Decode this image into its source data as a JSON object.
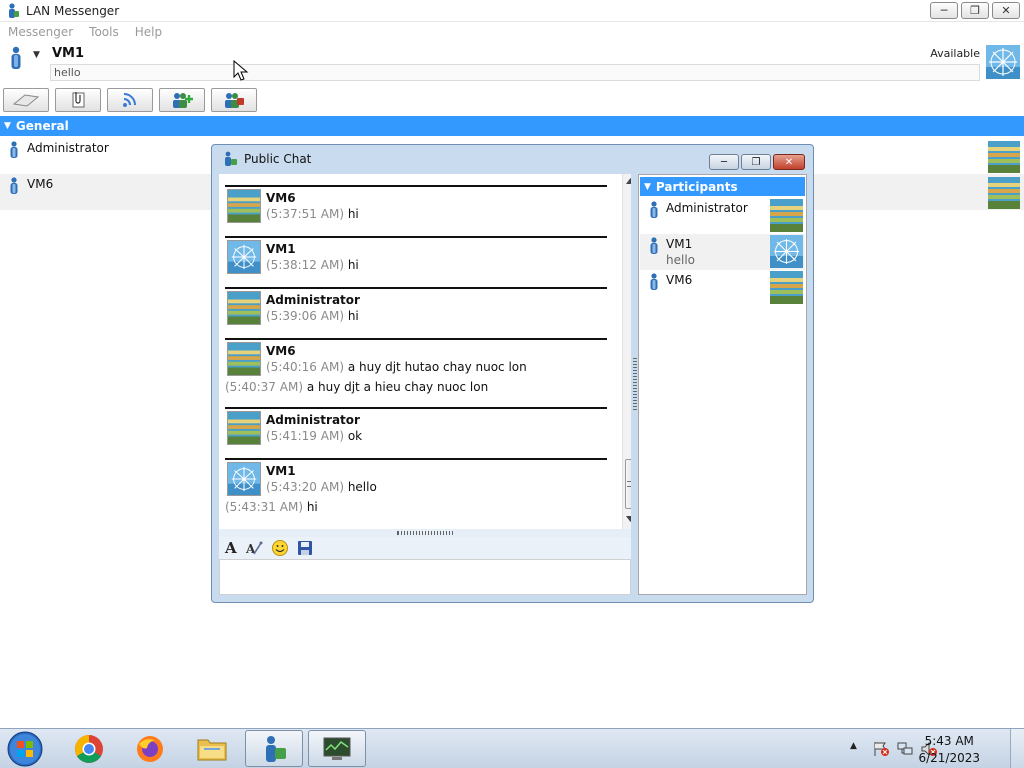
{
  "window": {
    "title": "LAN Messenger",
    "minimize_glyph": "─",
    "restore_glyph": "❐",
    "close_glyph": "✕"
  },
  "menu": [
    "Messenger",
    "Tools",
    "Help"
  ],
  "user": {
    "name": "VM1",
    "status_message": "hello",
    "availability": "Available",
    "caret": "▼"
  },
  "toolbar": {
    "buttons": [
      "chat-icon",
      "file-transfer-icon",
      "broadcast-icon",
      "add-contact-icon",
      "contact-settings-icon"
    ]
  },
  "contacts": {
    "group": "General",
    "group_caret": "▼",
    "items": [
      {
        "name": "Administrator"
      },
      {
        "name": "VM6"
      }
    ]
  },
  "chat": {
    "title": "Public Chat",
    "messages": [
      {
        "sender": "VM6",
        "time": "(5:37:51 AM)",
        "text": " hi"
      },
      {
        "sender": "VM1",
        "time": "(5:38:12 AM)",
        "text": " hi"
      },
      {
        "sender": "Administrator",
        "time": "(5:39:06 AM)",
        "text": " hi"
      },
      {
        "sender": "VM6",
        "time": "(5:40:16 AM)",
        "text": " a huy djt hutao chay nuoc lon",
        "time2": "(5:40:37 AM)",
        "text2": " a huy djt a hieu chay nuoc lon"
      },
      {
        "sender": "Administrator",
        "time": "(5:41:19 AM)",
        "text": " ok"
      },
      {
        "sender": "VM1",
        "time": "(5:43:20 AM)",
        "text": " hello",
        "time2": "(5:43:31 AM)",
        "text2": " hi"
      }
    ],
    "format_font_glyph": "A",
    "participants_header": "Participants",
    "participants": [
      {
        "name": "Administrator",
        "status": ""
      },
      {
        "name": "VM1",
        "status": "hello"
      },
      {
        "name": "VM6",
        "status": ""
      }
    ]
  },
  "taskbar": {
    "clock_time": "5:43 AM",
    "clock_date": "6/21/2023",
    "tray_arrow": "▲"
  },
  "colors": {
    "accent": "#3399ff",
    "chat_frame": "#c9dcef",
    "taskbar": "#c4d3e4"
  }
}
